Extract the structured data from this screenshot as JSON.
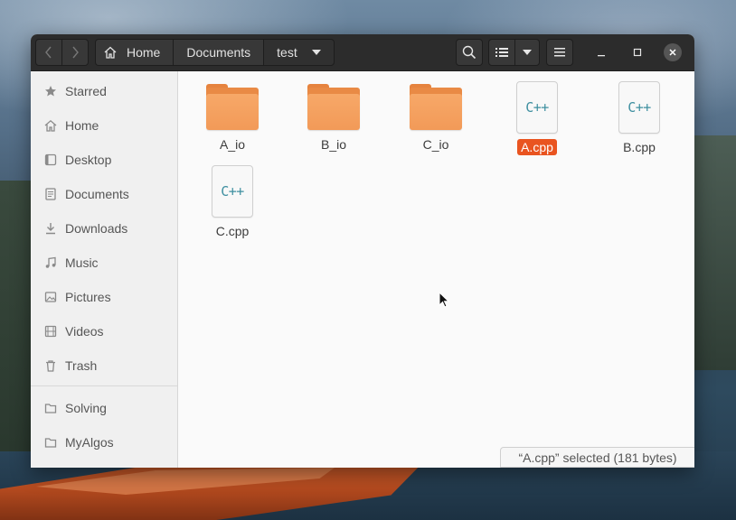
{
  "breadcrumbs": [
    {
      "label": "Home"
    },
    {
      "label": "Documents"
    },
    {
      "label": "test"
    }
  ],
  "sidebar": {
    "places": [
      {
        "label": "Starred",
        "icon": "star-icon"
      },
      {
        "label": "Home",
        "icon": "home-icon"
      },
      {
        "label": "Desktop",
        "icon": "desktop-icon"
      },
      {
        "label": "Documents",
        "icon": "document-icon"
      },
      {
        "label": "Downloads",
        "icon": "download-icon"
      },
      {
        "label": "Music",
        "icon": "music-icon"
      },
      {
        "label": "Pictures",
        "icon": "picture-icon"
      },
      {
        "label": "Videos",
        "icon": "video-icon"
      },
      {
        "label": "Trash",
        "icon": "trash-icon"
      }
    ],
    "bookmarks": [
      {
        "label": "Solving",
        "icon": "folder-icon"
      },
      {
        "label": "MyAlgos",
        "icon": "folder-icon"
      }
    ]
  },
  "files": [
    {
      "name": "A_io",
      "type": "folder",
      "selected": false
    },
    {
      "name": "B_io",
      "type": "folder",
      "selected": false
    },
    {
      "name": "C_io",
      "type": "folder",
      "selected": false
    },
    {
      "name": "A.cpp",
      "type": "cpp",
      "icon_text": "C++",
      "selected": true
    },
    {
      "name": "B.cpp",
      "type": "cpp",
      "icon_text": "C++",
      "selected": false
    },
    {
      "name": "C.cpp",
      "type": "cpp",
      "icon_text": "C++",
      "selected": false
    }
  ],
  "status": {
    "text": "“A.cpp” selected  (181 bytes)"
  },
  "colors": {
    "selection": "#e95420",
    "folder": "#f29a58",
    "headerbar": "#2c2c2c"
  }
}
